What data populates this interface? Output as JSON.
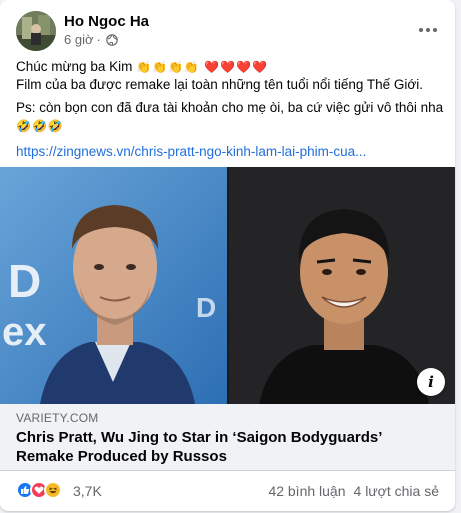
{
  "post": {
    "author": "Ho Ngoc Ha",
    "time": "6 giờ",
    "privacy_icon": "globe-icon",
    "lines": [
      "Chúc mừng ba Kim",
      "Film của ba được remake lại toàn những tên tuổi nổi tiếng Thế Giới.",
      "Ps: còn bọn con đã đưa tài khoản cho mẹ òi, ba cứ việc gửi vô thôi nha"
    ],
    "line1_emojis": "👏👏👏👏 ❤️❤️❤️❤️",
    "line3_emojis": "🤣🤣🤣",
    "link_text": "https://zingnews.vn/chris-pratt-ngo-kinh-lam-lai-phim-cua..."
  },
  "link_preview": {
    "domain": "VARIETY.COM",
    "headline": "Chris Pratt, Wu Jing to Star in ‘Saigon Bodyguards’ Remake Produced by Russos",
    "info_label": "i"
  },
  "stats": {
    "reaction_count": "3,7K",
    "comments": "42 bình luận",
    "shares": "4 lượt chia sẻ",
    "reactions": [
      "like",
      "love",
      "haha"
    ]
  },
  "colors": {
    "link": "#216fdb",
    "like": "#1877f2",
    "love": "#f33e58",
    "haha": "#f7b928"
  }
}
